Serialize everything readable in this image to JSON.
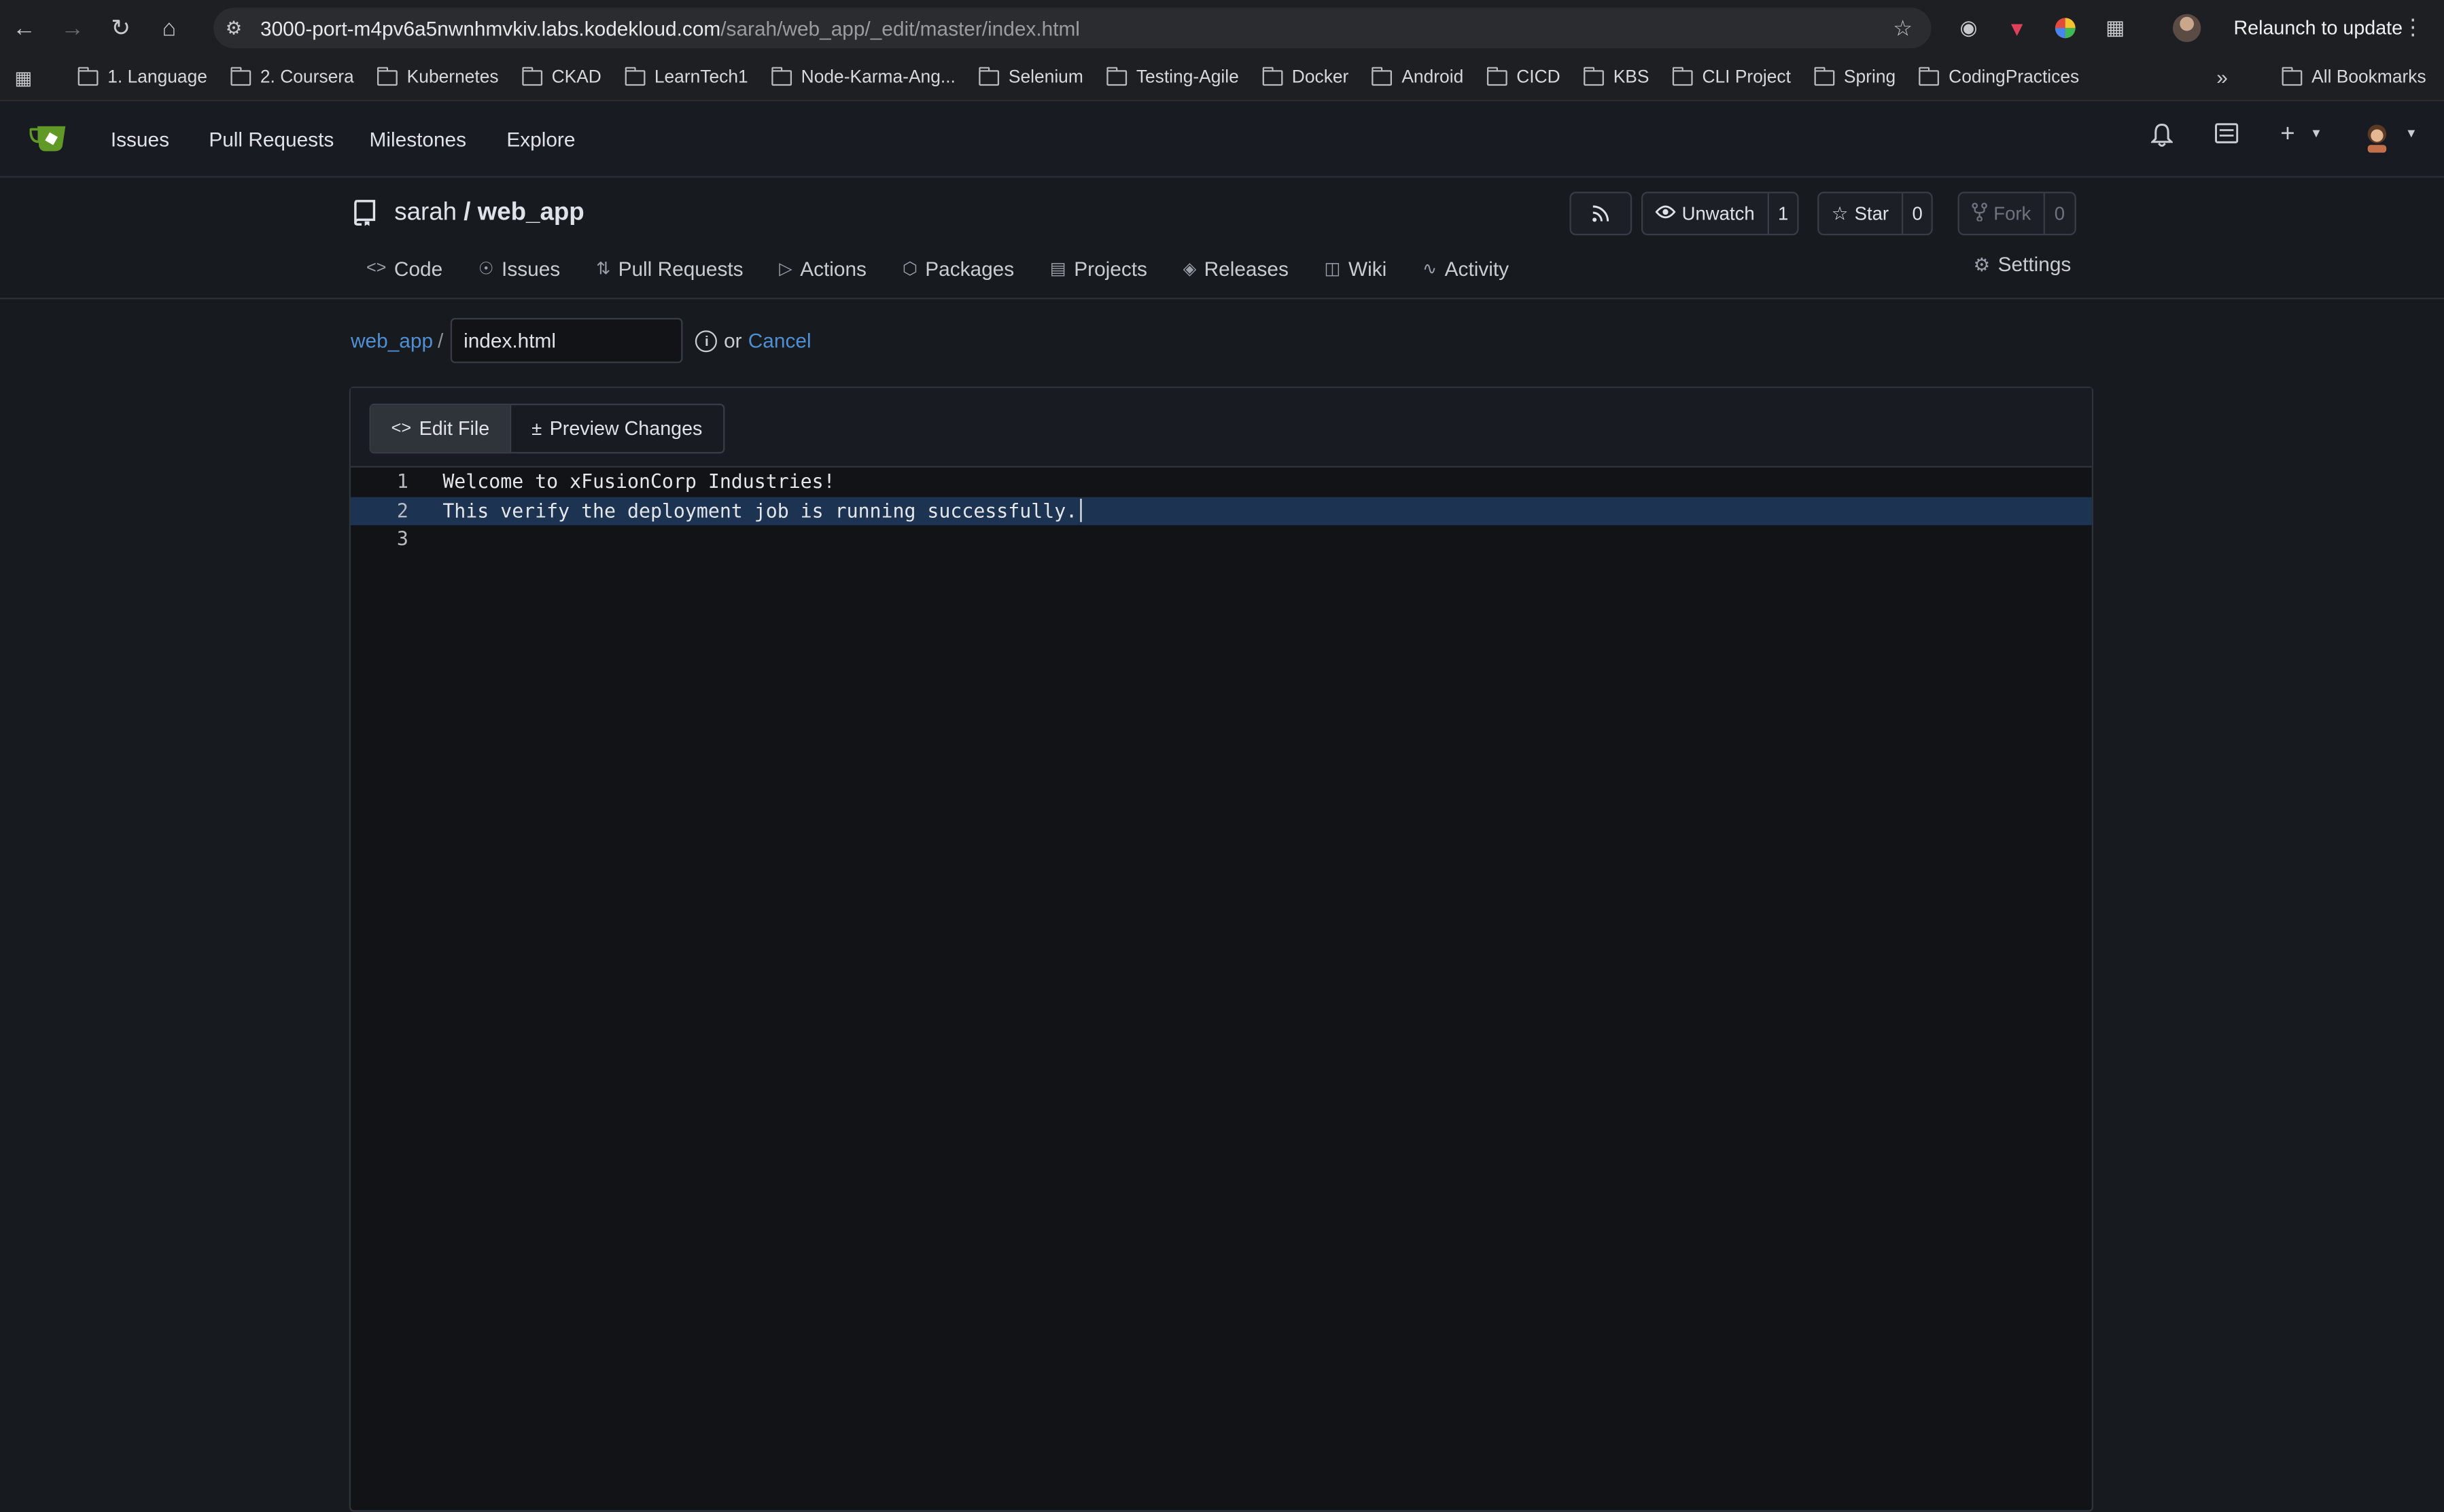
{
  "browser": {
    "url_host": "3000-port-m4pv6a5nwnhmvkiv.labs.kodekloud.com",
    "url_path": "/sarah/web_app/_edit/master/index.html",
    "relaunch_label": "Relaunch to update",
    "bookmarks": [
      "1. Language",
      "2. Coursera",
      "Kubernetes",
      "CKAD",
      "LearnTech1",
      "Node-Karma-Ang...",
      "Selenium",
      "Testing-Agile",
      "Docker",
      "Android",
      "CICD",
      "KBS",
      "CLI Project",
      "Spring",
      "CodingPractices"
    ],
    "all_bookmarks_label": "All Bookmarks"
  },
  "navbar": {
    "items": [
      "Issues",
      "Pull Requests",
      "Milestones",
      "Explore"
    ]
  },
  "repo": {
    "owner": "sarah",
    "separator": "/",
    "name": "web_app",
    "watch_label": "Unwatch",
    "watch_count": "1",
    "star_label": "Star",
    "star_count": "0",
    "fork_label": "Fork",
    "fork_count": "0",
    "tabs": [
      "Code",
      "Issues",
      "Pull Requests",
      "Actions",
      "Packages",
      "Projects",
      "Releases",
      "Wiki",
      "Activity"
    ],
    "settings_label": "Settings"
  },
  "editor": {
    "breadcrumb_repo": "web_app",
    "breadcrumb_sep": "/",
    "filename": "index.html",
    "or_text": "or",
    "cancel_label": "Cancel",
    "edit_tab_label": "Edit File",
    "preview_tab_label": "Preview Changes",
    "lines": [
      {
        "num": "1",
        "text": "Welcome to xFusionCorp Industries!"
      },
      {
        "num": "2",
        "text": "This verify the deployment job is running successfully."
      },
      {
        "num": "3",
        "text": ""
      }
    ],
    "highlighted_line": "2"
  },
  "colors": {
    "accent_link": "#4f8fd3",
    "highlight_line": "#1c3352",
    "gitea_green": "#609926"
  }
}
